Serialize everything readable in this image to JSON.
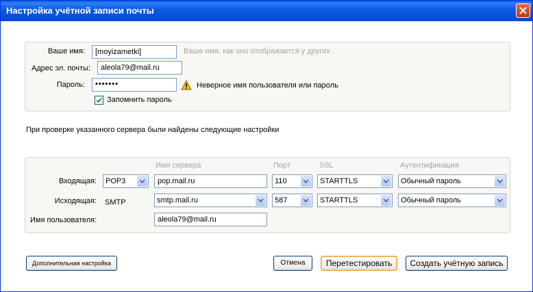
{
  "window": {
    "title": "Настройка учётной записи почты"
  },
  "account": {
    "name_label": "Ваше имя:",
    "name_value": "[moyizametki]",
    "name_hint": "Ваше имя, как оно отображается у других",
    "email_label": "Адрес эл. почты:",
    "email_value": "aleola79@mail.ru",
    "password_label": "Пароль:",
    "password_value": "•••••••",
    "password_error": "Неверное имя пользователя или пароль",
    "remember_label": "Запомнить пароль",
    "remember_checked": true
  },
  "status_message": "При проверке указанного сервера были найдены следующие настройки",
  "servers": {
    "headers": {
      "server": "Имя сервера",
      "port": "Порт",
      "ssl": "SSL",
      "auth": "Аутентификация"
    },
    "incoming": {
      "label": "Входящая:",
      "protocol": "POP3",
      "server": "pop.mail.ru",
      "port": "110",
      "ssl": "STARTTLS",
      "auth": "Обычный пароль"
    },
    "outgoing": {
      "label": "Исходящая:",
      "protocol": "SMTP",
      "server": "smtp.mail.ru",
      "port": "587",
      "ssl": "STARTTLS",
      "auth": "Обычный пароль"
    },
    "username_label": "Имя пользователя:",
    "username_value": "aleola79@mail.ru"
  },
  "buttons": {
    "advanced": "Дополнительная настройка",
    "cancel": "Отмена",
    "retest": "Перетестировать",
    "create": "Создать учётную запись"
  },
  "colors": {
    "titlebar": "#0a5ae0",
    "close_button": "#c2350c",
    "warning": "#f0c020"
  }
}
